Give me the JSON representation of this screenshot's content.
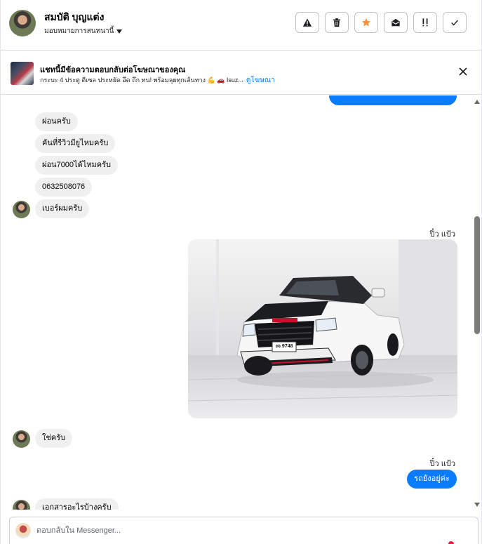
{
  "header": {
    "contact_name": "สมบัติ บุญแต่ง",
    "assign_label": "มอบหมายการสนทนานี้",
    "actions": [
      "warning-icon",
      "trash-icon",
      "star-icon",
      "envelope-open-icon",
      "mark-important-icon",
      "check-icon"
    ]
  },
  "ad_banner": {
    "title": "แชทนี้มีข้อความตอบกลับต่อโฆษณาของคุณ",
    "subtitle": "กระบะ 4 ประตู ดีเซล ประหยัด อึด ถึก ทน! พร้อมลุยทุกเส้นทาง 💪 🚗 Isuz...",
    "link": "ดูโฆษณา"
  },
  "messages": [
    {
      "from": "contact",
      "text": "ผ่อนครับ"
    },
    {
      "from": "contact",
      "text": "คันที่รีวิวมียูไหมครับ"
    },
    {
      "from": "contact",
      "text": "ผ่อน7000ได้ไหมครับ"
    },
    {
      "from": "contact",
      "text": "0632508076"
    },
    {
      "from": "contact",
      "text": "เบอร์ผมครับ"
    },
    {
      "from": "page",
      "sender": "ปิ๋ว แป้ว",
      "type": "image",
      "plate": "งจ 9748"
    },
    {
      "from": "contact",
      "text": "ใช่ครับ"
    },
    {
      "from": "page",
      "sender": "ปิ๋ว แป้ว",
      "text": "รถยังอยู่ค่ะ"
    },
    {
      "from": "contact",
      "text": "เอกสารอะไรบ้างครับ"
    }
  ],
  "composer": {
    "placeholder": "ตอบกลับใน Messenger..."
  },
  "colors": {
    "accent": "#0a7cff",
    "star": "#f7923b",
    "incoming_bubble": "#f0f0f0"
  }
}
